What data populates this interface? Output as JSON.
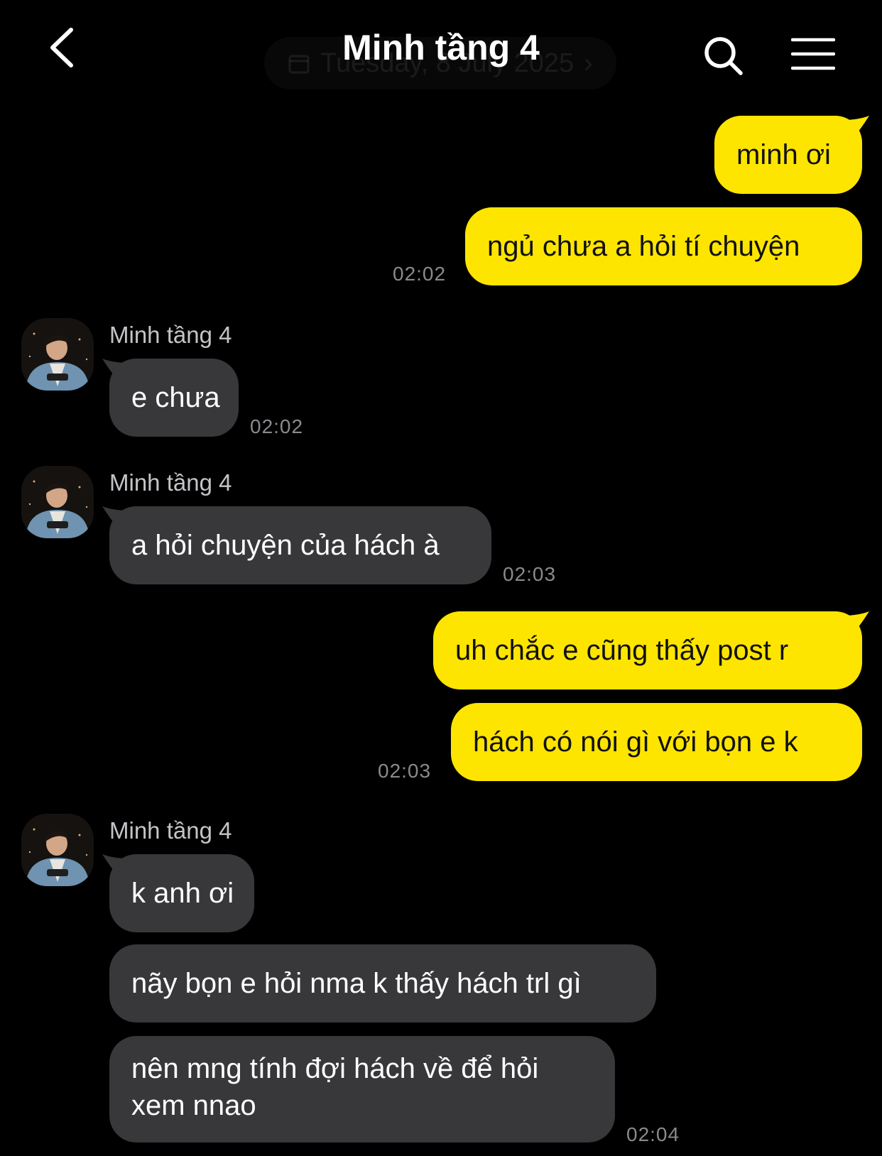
{
  "header": {
    "title": "Minh tầng 4",
    "date_label": "Tuesday, 8 July 2025"
  },
  "colors": {
    "outgoing": "#FEE500",
    "incoming": "#38383a",
    "background": "#000000"
  },
  "icons": [
    "chevron-left-icon",
    "search-icon",
    "hamburger-menu-icon",
    "calendar-icon",
    "chevron-right-icon"
  ],
  "messages": [
    {
      "sender": "me",
      "text": "minh ơi"
    },
    {
      "sender": "me",
      "text": "ngủ chưa a hỏi tí chuyện",
      "time": "02:02"
    },
    {
      "sender": "Minh tầng 4",
      "text": "e chưa",
      "time": "02:02"
    },
    {
      "sender": "Minh tầng 4",
      "text": "a hỏi chuyện của hách à",
      "time": "02:03"
    },
    {
      "sender": "me",
      "text": "uh chắc e cũng thấy post r"
    },
    {
      "sender": "me",
      "text": "hách có nói gì với bọn e k",
      "time": "02:03"
    },
    {
      "sender": "Minh tầng 4",
      "text": "k anh ơi"
    },
    {
      "sender": "Minh tầng 4",
      "text": "nãy bọn e hỏi nma k thấy hách trl gì"
    },
    {
      "sender": "Minh tầng 4",
      "text": "nên mng tính đợi hách về để hỏi xem nnao",
      "time": "02:04"
    }
  ]
}
